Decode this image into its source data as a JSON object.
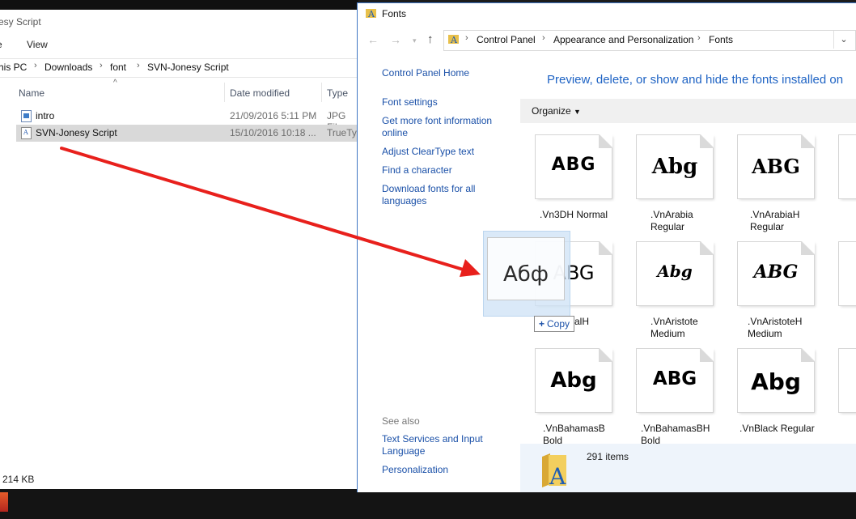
{
  "explorer": {
    "title": "esy Script",
    "ribbon": {
      "tab_partial": "e",
      "view": "View"
    },
    "breadcrumb": [
      "his PC",
      "Downloads",
      "font",
      "SVN-Jonesy Script"
    ],
    "columns": {
      "name": "Name",
      "date_modified": "Date modified",
      "type": "Type"
    },
    "rows": [
      {
        "name": "intro",
        "date": "21/09/2016 5:11 PM",
        "type": "JPG File",
        "icon": "image-file-icon"
      },
      {
        "name": "SVN-Jonesy Script",
        "date": "15/10/2016 10:18 ...",
        "type": "TrueType",
        "icon": "font-file-icon"
      }
    ],
    "status": "214 KB"
  },
  "fonts_window": {
    "title": "Fonts",
    "breadcrumb": [
      "Control Panel",
      "Appearance and Personalization",
      "Fonts"
    ],
    "sidebar": {
      "home": "Control Panel Home",
      "links": [
        "Font settings",
        "Get more font information online",
        "Adjust ClearType text",
        "Find a character",
        "Download fonts for all languages"
      ],
      "see_also_label": "See also",
      "see_also": [
        "Text Services and Input Language",
        "Personalization"
      ]
    },
    "heading": "Preview, delete, or show and hide the fonts installed on",
    "toolbar": {
      "organize": "Organize"
    },
    "fonts": [
      {
        "sample": "ABG",
        "label": ".Vn3DH Normal"
      },
      {
        "sample": "Abg",
        "label": ".VnArabia Regular"
      },
      {
        "sample": "ABG",
        "label": ".VnArabiaH Regular"
      },
      {
        "sample": "ABG",
        "label": "alH"
      },
      {
        "sample": "Abg",
        "label": ".VnAristote Medium"
      },
      {
        "sample": "ABG",
        "label": ".VnAristoteH Medium"
      },
      {
        "sample": "Abg",
        "label": ".VnBahamasB Bold"
      },
      {
        "sample": "ABG",
        "label": ".VnBahamasBH Bold"
      },
      {
        "sample": "Abg",
        "label": ".VnBlack Regular"
      }
    ],
    "item_count": "291 items"
  },
  "drag": {
    "preview_text": "Абф",
    "copy_label": "Copy"
  },
  "colors": {
    "arrow": "#e8201c",
    "link": "#1a50a8",
    "heading": "#1e63c4",
    "selection": "#d9d9d9"
  }
}
